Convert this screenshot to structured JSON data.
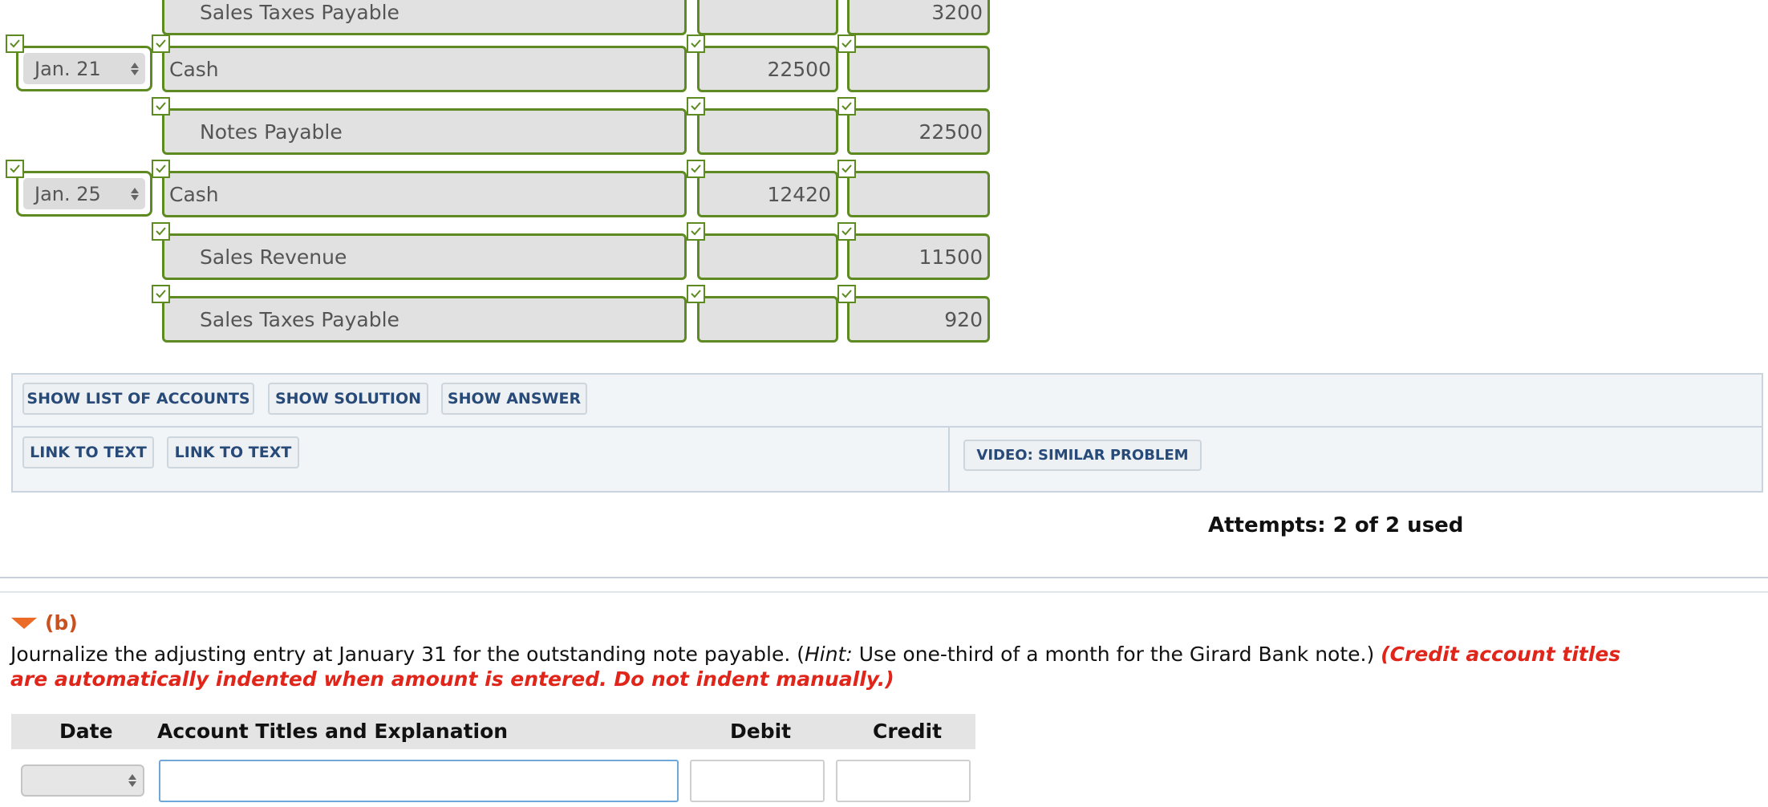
{
  "part_a": {
    "rows": [
      {
        "date": "",
        "account": "Sales Taxes Payable",
        "debit": "",
        "credit": "3200",
        "indent": true
      },
      {
        "date": "Jan. 21",
        "account": "Cash",
        "debit": "22500",
        "credit": "",
        "indent": false
      },
      {
        "date": "",
        "account": "Notes Payable",
        "debit": "",
        "credit": "22500",
        "indent": true
      },
      {
        "date": "Jan. 25",
        "account": "Cash",
        "debit": "12420",
        "credit": "",
        "indent": false
      },
      {
        "date": "",
        "account": "Sales Revenue",
        "debit": "",
        "credit": "11500",
        "indent": true
      },
      {
        "date": "",
        "account": "Sales Taxes Payable",
        "debit": "",
        "credit": "920",
        "indent": true
      }
    ],
    "field_state_color": "#5e8a22"
  },
  "buttons": {
    "show_list_of_accounts": "SHOW LIST OF ACCOUNTS",
    "show_solution": "SHOW SOLUTION",
    "show_answer": "SHOW ANSWER",
    "link_to_text_1": "LINK TO TEXT",
    "link_to_text_2": "LINK TO TEXT",
    "video_similar_problem": "VIDEO: SIMILAR PROBLEM"
  },
  "attempts": "Attempts: 2 of 2 used",
  "part_b": {
    "label": "(b)",
    "instruction_text": "Journalize the adjusting entry at January 31 for the outstanding note payable. (",
    "hint_label": "Hint:",
    "hint_text": " Use one-third of a month for the Girard Bank note.) ",
    "red_note": "(Credit account titles are automatically indented when amount is entered. Do not indent manually.)",
    "table_headers": {
      "date": "Date",
      "account": "Account Titles and Explanation",
      "debit": "Debit",
      "credit": "Credit"
    },
    "entry": {
      "date": "",
      "account": "",
      "debit": "",
      "credit": ""
    }
  },
  "colors": {
    "correct_border": "#5e8a22",
    "button_text": "#274a78",
    "section_label": "#c8511e",
    "warning_red": "#e0251b",
    "input_focus": "#6fa8d8"
  }
}
